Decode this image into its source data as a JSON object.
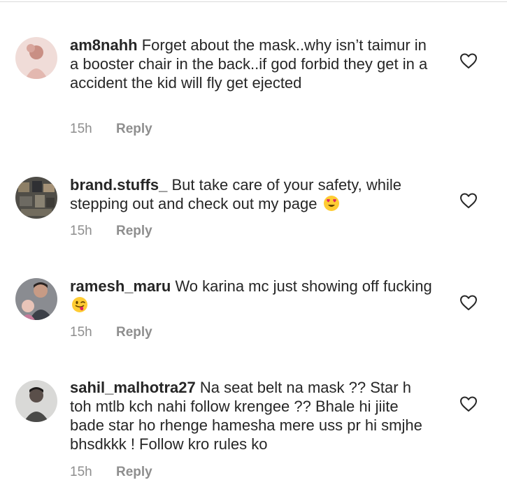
{
  "comments": [
    {
      "username": "am8nahh",
      "text": "Forget about the mask..why isn’t taimur in a booster chair in the back..if god forbid they get in a accident the kid will fly get ejected",
      "emoji": "",
      "time": "15h",
      "reply_label": "Reply",
      "avatar_colors": [
        "#e9c9c4",
        "#c98f84"
      ]
    },
    {
      "username": "brand.stuffs_",
      "text": "But take care of your safety, while stepping out and check out my page",
      "emoji": "heart-eyes-emoji",
      "time": "15h",
      "reply_label": "Reply",
      "avatar_colors": [
        "#5b5a53",
        "#8d7f66"
      ]
    },
    {
      "username": "ramesh_maru",
      "text": "Wo karina mc just showing off fucking",
      "emoji": "winking-tongue-emoji",
      "time": "15h",
      "reply_label": "Reply",
      "avatar_colors": [
        "#6b6d73",
        "#c7a39a"
      ]
    },
    {
      "username": "sahil_malhotra27",
      "text": "Na seat belt na mask ?? Star h toh mtlb kch nahi follow krengee ?? Bhale hi jiite bade star ho rhenge hamesha mere uss pr hi smjhe bhsdkkk ! Follow kro rules ko",
      "emoji": "",
      "time": "15h",
      "reply_label": "Reply",
      "avatar_colors": [
        "#d7d7d5",
        "#4a4a48"
      ]
    }
  ],
  "icons": {
    "like": "heart-outline-icon"
  },
  "colors": {
    "text": "#262626",
    "meta": "#8e8e8e",
    "divider": "#dbdbdb"
  }
}
